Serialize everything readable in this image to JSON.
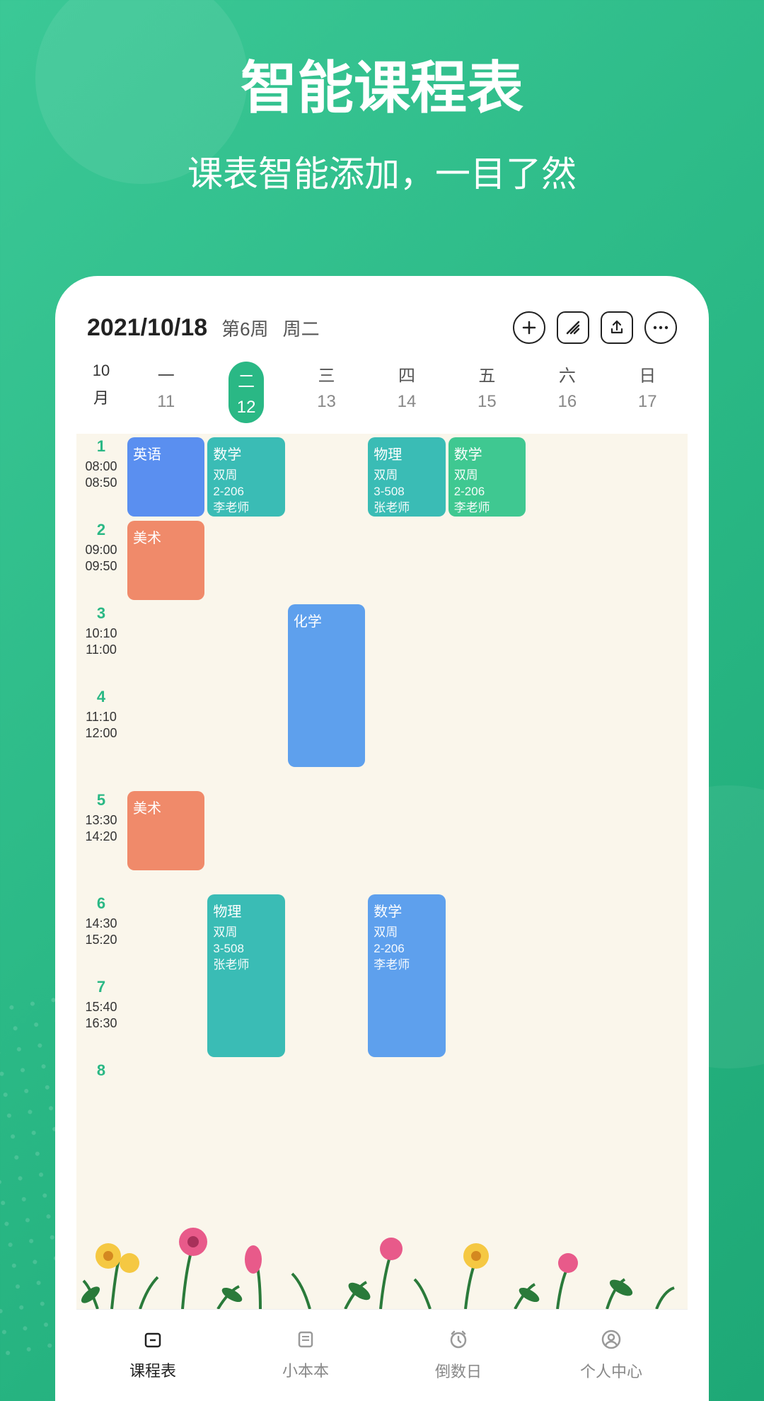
{
  "promo": {
    "title": "智能课程表",
    "subtitle": "课表智能添加，一目了然"
  },
  "header": {
    "date": "2021/10/18",
    "week": "第6周",
    "weekday": "周二"
  },
  "monthCol": {
    "top": "10",
    "bottom": "月"
  },
  "weekdays": [
    {
      "label": "一",
      "num": "11",
      "active": false
    },
    {
      "label": "二",
      "num": "12",
      "active": true
    },
    {
      "label": "三",
      "num": "13",
      "active": false
    },
    {
      "label": "四",
      "num": "14",
      "active": false
    },
    {
      "label": "五",
      "num": "15",
      "active": false
    },
    {
      "label": "六",
      "num": "16",
      "active": false
    },
    {
      "label": "日",
      "num": "17",
      "active": false
    }
  ],
  "timeSlots": [
    {
      "num": "1",
      "start": "08:00",
      "end": "08:50"
    },
    {
      "num": "2",
      "start": "09:00",
      "end": "09:50"
    },
    {
      "num": "3",
      "start": "10:10",
      "end": "11:00"
    },
    {
      "num": "4",
      "start": "11:10",
      "end": "12:00"
    },
    {
      "num": "5",
      "start": "13:30",
      "end": "14:20"
    },
    {
      "num": "6",
      "start": "14:30",
      "end": "15:20"
    },
    {
      "num": "7",
      "start": "15:40",
      "end": "16:30"
    },
    {
      "num": "8",
      "start": "",
      "end": ""
    }
  ],
  "courses": [
    {
      "day": 0,
      "slot": 0,
      "span": 1,
      "name": "英语",
      "sub": "",
      "color": "c-blue"
    },
    {
      "day": 0,
      "slot": 1,
      "span": 1,
      "name": "美术",
      "sub": "",
      "color": "c-orange"
    },
    {
      "day": 0,
      "slot": 4,
      "span": 1,
      "name": "美术",
      "sub": "",
      "color": "c-orange"
    },
    {
      "day": 1,
      "slot": 0,
      "span": 1,
      "name": "数学",
      "sub": "双周\n2-206\n李老师",
      "color": "c-teal"
    },
    {
      "day": 1,
      "slot": 5,
      "span": 2,
      "name": "物理",
      "sub": "双周\n3-508\n张老师",
      "color": "c-teal"
    },
    {
      "day": 2,
      "slot": 2,
      "span": 2,
      "name": "化学",
      "sub": "",
      "color": "c-bluelight"
    },
    {
      "day": 3,
      "slot": 0,
      "span": 1,
      "name": "物理",
      "sub": "双周\n3-508\n张老师",
      "color": "c-teal"
    },
    {
      "day": 3,
      "slot": 5,
      "span": 2,
      "name": "数学",
      "sub": "双周\n2-206\n李老师",
      "color": "c-bluelight"
    },
    {
      "day": 4,
      "slot": 0,
      "span": 1,
      "name": "数学",
      "sub": "双周\n2-206\n李老师",
      "color": "c-green"
    }
  ],
  "tabs": [
    {
      "label": "课程表",
      "icon": "calendar-icon",
      "active": true
    },
    {
      "label": "小本本",
      "icon": "note-icon",
      "active": false
    },
    {
      "label": "倒数日",
      "icon": "clock-icon",
      "active": false
    },
    {
      "label": "个人中心",
      "icon": "profile-icon",
      "active": false
    }
  ]
}
